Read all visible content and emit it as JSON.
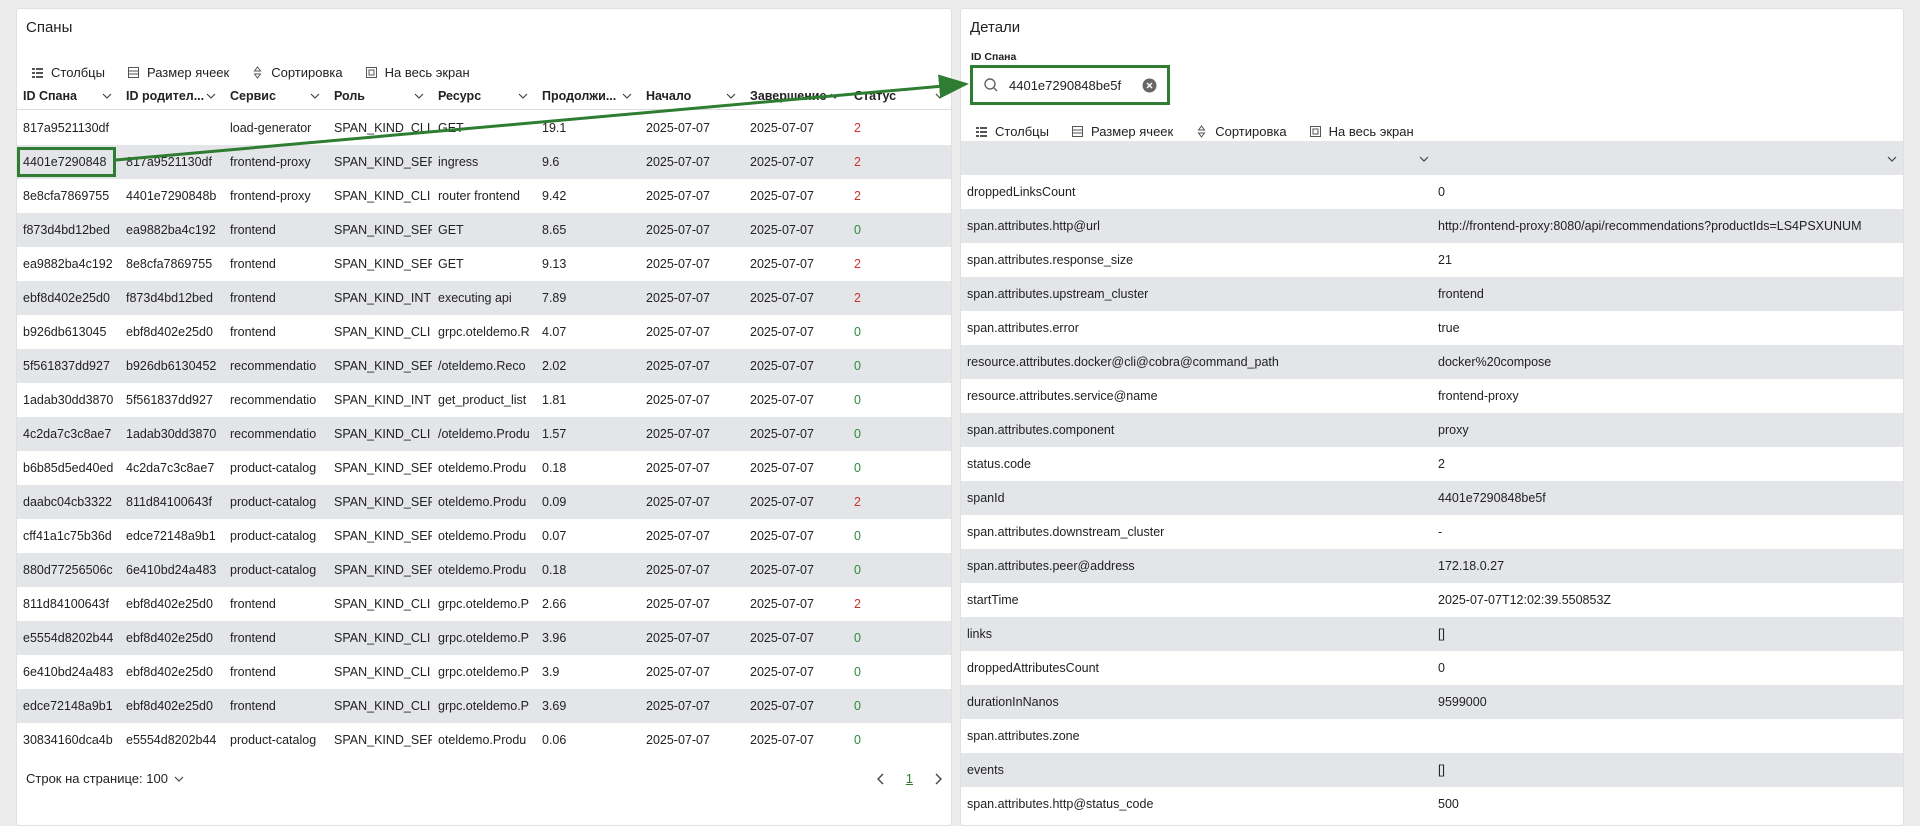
{
  "left": {
    "title": "Спаны",
    "toolbar": {
      "columns": "Столбцы",
      "cell_size": "Размер ячеек",
      "sort": "Сортировка",
      "fullscreen": "На весь экран"
    },
    "columns": [
      "ID Спана",
      "ID родител...",
      "Сервис",
      "Роль",
      "Ресурс",
      "Продолжи...",
      "Начало",
      "Завершение",
      "Статус"
    ],
    "rows": [
      {
        "id": "817a9521130df",
        "parent": "",
        "service": "load-generator",
        "role": "SPAN_KIND_CLI",
        "resource": "GET",
        "duration": "19.1",
        "start": "2025-07-07",
        "end": "2025-07-07",
        "status": "2"
      },
      {
        "id": "4401e7290848",
        "parent": "817a9521130df",
        "service": "frontend-proxy",
        "role": "SPAN_KIND_SER",
        "resource": "ingress",
        "duration": "9.6",
        "start": "2025-07-07",
        "end": "2025-07-07",
        "status": "2"
      },
      {
        "id": "8e8cfa7869755",
        "parent": "4401e7290848b",
        "service": "frontend-proxy",
        "role": "SPAN_KIND_CLI",
        "resource": "router frontend",
        "duration": "9.42",
        "start": "2025-07-07",
        "end": "2025-07-07",
        "status": "2"
      },
      {
        "id": "f873d4bd12bed",
        "parent": "ea9882ba4c192",
        "service": "frontend",
        "role": "SPAN_KIND_SER",
        "resource": "GET",
        "duration": "8.65",
        "start": "2025-07-07",
        "end": "2025-07-07",
        "status": "0"
      },
      {
        "id": "ea9882ba4c192",
        "parent": "8e8cfa7869755",
        "service": "frontend",
        "role": "SPAN_KIND_SER",
        "resource": "GET",
        "duration": "9.13",
        "start": "2025-07-07",
        "end": "2025-07-07",
        "status": "2"
      },
      {
        "id": "ebf8d402e25d0",
        "parent": "f873d4bd12bed",
        "service": "frontend",
        "role": "SPAN_KIND_INT",
        "resource": "executing api",
        "duration": "7.89",
        "start": "2025-07-07",
        "end": "2025-07-07",
        "status": "2"
      },
      {
        "id": "b926db613045",
        "parent": "ebf8d402e25d0",
        "service": "frontend",
        "role": "SPAN_KIND_CLI",
        "resource": "grpc.oteldemo.R",
        "duration": "4.07",
        "start": "2025-07-07",
        "end": "2025-07-07",
        "status": "0"
      },
      {
        "id": "5f561837dd927",
        "parent": "b926db6130452",
        "service": "recommendatio",
        "role": "SPAN_KIND_SER",
        "resource": "/oteldemo.Reco",
        "duration": "2.02",
        "start": "2025-07-07",
        "end": "2025-07-07",
        "status": "0"
      },
      {
        "id": "1adab30dd3870",
        "parent": "5f561837dd927",
        "service": "recommendatio",
        "role": "SPAN_KIND_INT",
        "resource": "get_product_list",
        "duration": "1.81",
        "start": "2025-07-07",
        "end": "2025-07-07",
        "status": "0"
      },
      {
        "id": "4c2da7c3c8ae7",
        "parent": "1adab30dd3870",
        "service": "recommendatio",
        "role": "SPAN_KIND_CLI",
        "resource": "/oteldemo.Produ",
        "duration": "1.57",
        "start": "2025-07-07",
        "end": "2025-07-07",
        "status": "0"
      },
      {
        "id": "b6b85d5ed40ed",
        "parent": "4c2da7c3c8ae7",
        "service": "product-catalog",
        "role": "SPAN_KIND_SER",
        "resource": "oteldemo.Produ",
        "duration": "0.18",
        "start": "2025-07-07",
        "end": "2025-07-07",
        "status": "0"
      },
      {
        "id": "daabc04cb3322",
        "parent": "811d84100643f",
        "service": "product-catalog",
        "role": "SPAN_KIND_SER",
        "resource": "oteldemo.Produ",
        "duration": "0.09",
        "start": "2025-07-07",
        "end": "2025-07-07",
        "status": "2"
      },
      {
        "id": "cff41a1c75b36d",
        "parent": "edce72148a9b1",
        "service": "product-catalog",
        "role": "SPAN_KIND_SER",
        "resource": "oteldemo.Produ",
        "duration": "0.07",
        "start": "2025-07-07",
        "end": "2025-07-07",
        "status": "0"
      },
      {
        "id": "880d77256506c",
        "parent": "6e410bd24a483",
        "service": "product-catalog",
        "role": "SPAN_KIND_SER",
        "resource": "oteldemo.Produ",
        "duration": "0.18",
        "start": "2025-07-07",
        "end": "2025-07-07",
        "status": "0"
      },
      {
        "id": "811d84100643f",
        "parent": "ebf8d402e25d0",
        "service": "frontend",
        "role": "SPAN_KIND_CLI",
        "resource": "grpc.oteldemo.P",
        "duration": "2.66",
        "start": "2025-07-07",
        "end": "2025-07-07",
        "status": "2"
      },
      {
        "id": "e5554d8202b44",
        "parent": "ebf8d402e25d0",
        "service": "frontend",
        "role": "SPAN_KIND_CLI",
        "resource": "grpc.oteldemo.P",
        "duration": "3.96",
        "start": "2025-07-07",
        "end": "2025-07-07",
        "status": "0"
      },
      {
        "id": "6e410bd24a483",
        "parent": "ebf8d402e25d0",
        "service": "frontend",
        "role": "SPAN_KIND_CLI",
        "resource": "grpc.oteldemo.P",
        "duration": "3.9",
        "start": "2025-07-07",
        "end": "2025-07-07",
        "status": "0"
      },
      {
        "id": "edce72148a9b1",
        "parent": "ebf8d402e25d0",
        "service": "frontend",
        "role": "SPAN_KIND_CLI",
        "resource": "grpc.oteldemo.P",
        "duration": "3.69",
        "start": "2025-07-07",
        "end": "2025-07-07",
        "status": "0"
      },
      {
        "id": "30834160dca4b",
        "parent": "e5554d8202b44",
        "service": "product-catalog",
        "role": "SPAN_KIND_SER",
        "resource": "oteldemo.Produ",
        "duration": "0.06",
        "start": "2025-07-07",
        "end": "2025-07-07",
        "status": "0"
      }
    ],
    "footer": {
      "rows_per_page": "Строк на странице: 100",
      "page": "1"
    }
  },
  "right": {
    "title": "Детали",
    "id_label": "ID Спана",
    "search_value": "4401e7290848be5f",
    "toolbar": {
      "columns": "Столбцы",
      "cell_size": "Размер ячеек",
      "sort": "Сортировка",
      "fullscreen": "На весь экран"
    },
    "details": [
      {
        "key": "droppedLinksCount",
        "value": "0"
      },
      {
        "key": "span.attributes.http@url",
        "value": "http://frontend-proxy:8080/api/recommendations?productIds=LS4PSXUNUM"
      },
      {
        "key": "span.attributes.response_size",
        "value": "21"
      },
      {
        "key": "span.attributes.upstream_cluster",
        "value": "frontend"
      },
      {
        "key": "span.attributes.error",
        "value": "true"
      },
      {
        "key": "resource.attributes.docker@cli@cobra@command_path",
        "value": "docker%20compose"
      },
      {
        "key": "resource.attributes.service@name",
        "value": "frontend-proxy"
      },
      {
        "key": "span.attributes.component",
        "value": "proxy"
      },
      {
        "key": "status.code",
        "value": "2"
      },
      {
        "key": "spanId",
        "value": "4401e7290848be5f"
      },
      {
        "key": "span.attributes.downstream_cluster",
        "value": "-"
      },
      {
        "key": "span.attributes.peer@address",
        "value": "172.18.0.27"
      },
      {
        "key": "startTime",
        "value": "2025-07-07T12:02:39.550853Z"
      },
      {
        "key": "links",
        "value": "[]"
      },
      {
        "key": "droppedAttributesCount",
        "value": "0"
      },
      {
        "key": "durationInNanos",
        "value": "9599000"
      },
      {
        "key": "span.attributes.zone",
        "value": ""
      },
      {
        "key": "events",
        "value": "[]"
      },
      {
        "key": "span.attributes.http@status_code",
        "value": "500"
      }
    ]
  },
  "colors": {
    "accent_green": "#2e7d32",
    "status_error": "#d0312d",
    "status_ok": "#2e8b3a",
    "row_alt": "#e4e5e8"
  }
}
